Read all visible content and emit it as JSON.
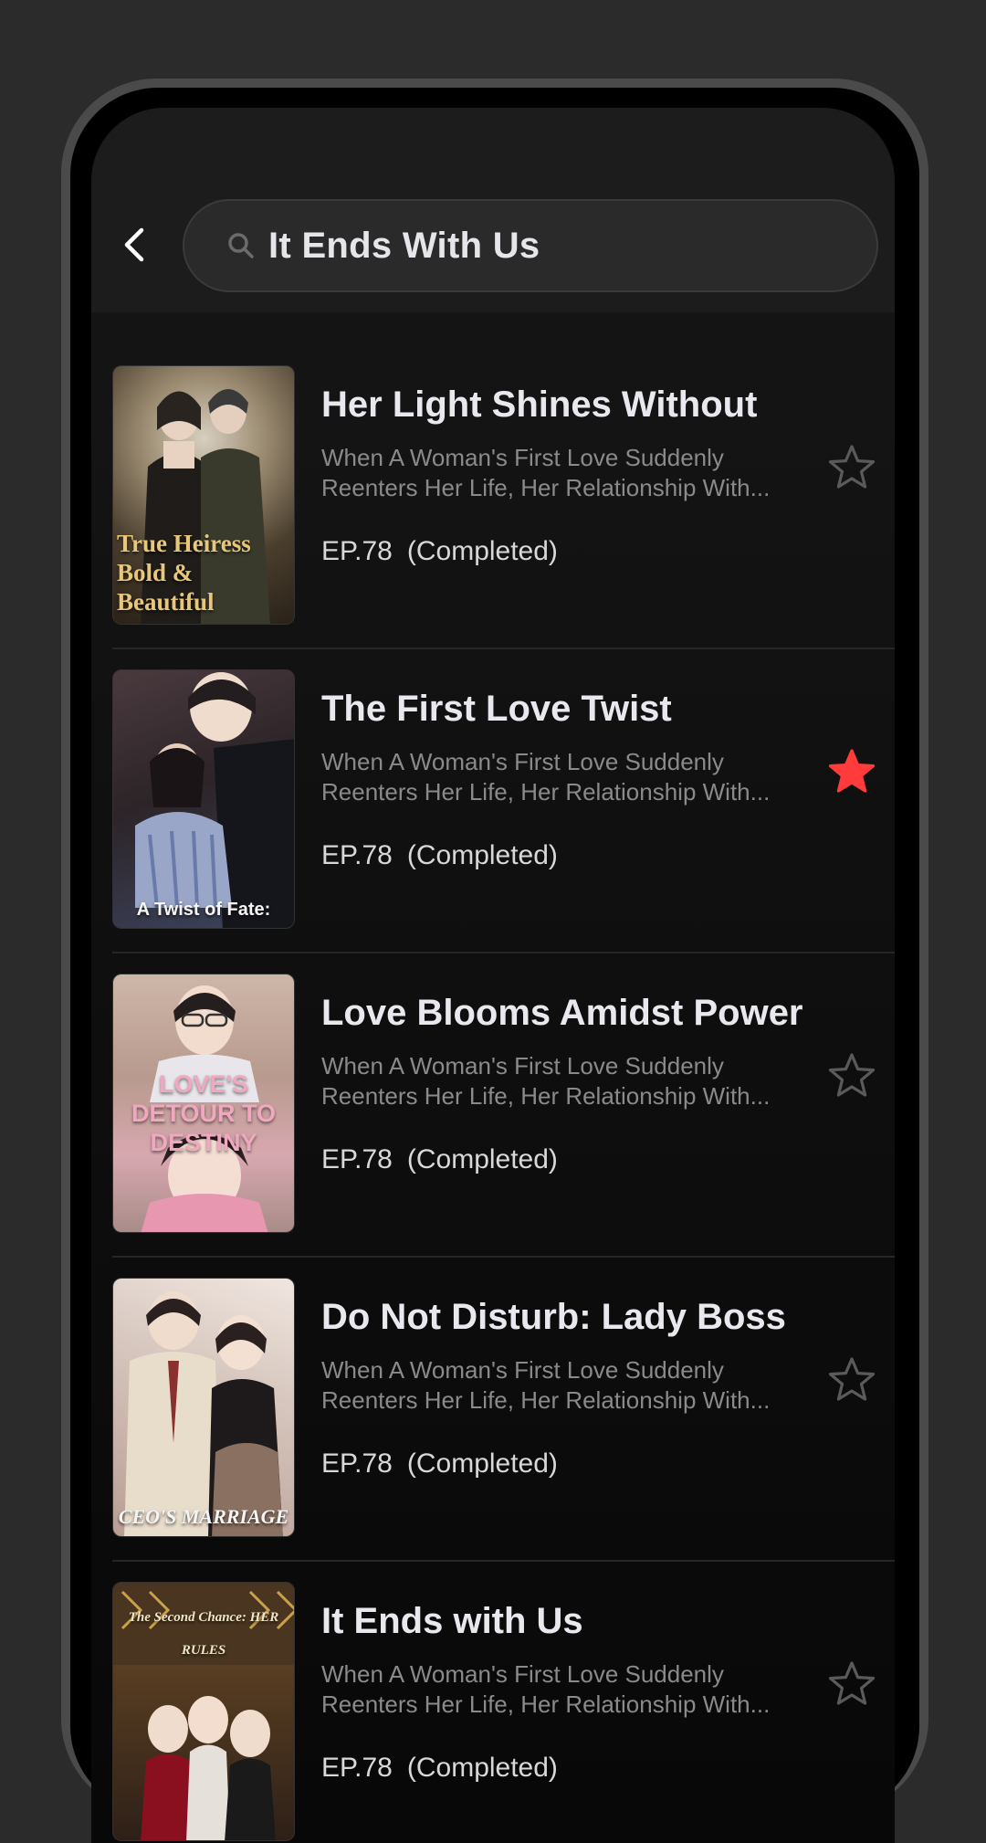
{
  "search": {
    "query": "It Ends With Us"
  },
  "results": [
    {
      "title": "Her Light Shines Without",
      "desc_line1": "When A Woman's First Love Suddenly",
      "desc_line2": "Reenters Her Life, Her Relationship With...",
      "episodes": "EP.78",
      "status": "(Completed)",
      "poster_text": "True Heiress Bold & Beautiful",
      "favorited": false
    },
    {
      "title": "The First Love Twist",
      "desc_line1": "When A Woman's First Love Suddenly",
      "desc_line2": "Reenters Her Life, Her Relationship With...",
      "episodes": "EP.78",
      "status": "(Completed)",
      "poster_text": "A Twist of Fate:",
      "favorited": true
    },
    {
      "title": "Love Blooms Amidst Power",
      "desc_line1": "When A Woman's First Love Suddenly",
      "desc_line2": "Reenters Her Life, Her Relationship With...",
      "episodes": "EP.78",
      "status": "(Completed)",
      "poster_text": "LOVE'S DETOUR TO DESTINY",
      "favorited": false
    },
    {
      "title": "Do Not Disturb: Lady Boss",
      "desc_line1": "When A Woman's First Love Suddenly",
      "desc_line2": "Reenters Her Life, Her Relationship With...",
      "episodes": "EP.78",
      "status": "(Completed)",
      "poster_text": "CEO'S MARRIAGE",
      "favorited": false
    },
    {
      "title": "It Ends with Us",
      "desc_line1": "When A Woman's First Love Suddenly",
      "desc_line2": "Reenters Her Life, Her Relationship With...",
      "episodes": "EP.78",
      "status": "(Completed)",
      "poster_text": "The Second Chance: HER RULES",
      "favorited": false
    }
  ],
  "colors": {
    "star_active": "#ff3b3b",
    "star_inactive": "#5a5a5a",
    "background": "#2b2b2b"
  },
  "icons": {
    "back": "chevron-left-icon",
    "search": "search-icon",
    "favorite": "star-icon"
  }
}
